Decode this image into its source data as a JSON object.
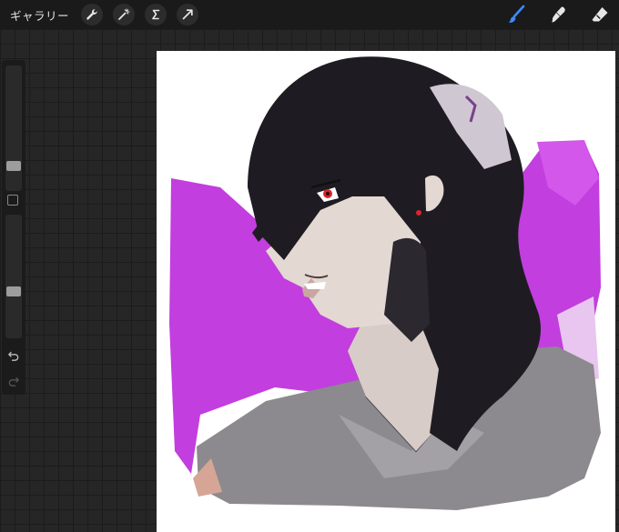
{
  "topbar": {
    "gallery_label": "ギャラリー",
    "left_tools": [
      {
        "icon": "wrench-icon"
      },
      {
        "icon": "magic-wand-icon"
      },
      {
        "icon": "selection-icon"
      },
      {
        "icon": "transform-arrow-icon"
      }
    ],
    "right_tools": [
      {
        "icon": "brush-icon",
        "active": true
      },
      {
        "icon": "smudge-icon",
        "active": false
      },
      {
        "icon": "eraser-icon",
        "active": false
      }
    ],
    "colors": {
      "bar": "#1a1a1a",
      "active_tool": "#3d8bff",
      "inactive_tool": "#e6e6e6"
    }
  },
  "sidebar": {
    "brush_size": 0.17,
    "opacity": 0.37,
    "icons": [
      "modify-square-icon",
      "undo-icon",
      "redo-icon"
    ]
  },
  "canvas": {
    "content": "artwork-illustration",
    "colors": {
      "background": "#ffffff",
      "accent_magenta": "#c23ede",
      "hair": "#1e1c22",
      "shirt": "#8c8a8e",
      "skin": "#e3d8d2",
      "eye": "#d8262b"
    }
  }
}
